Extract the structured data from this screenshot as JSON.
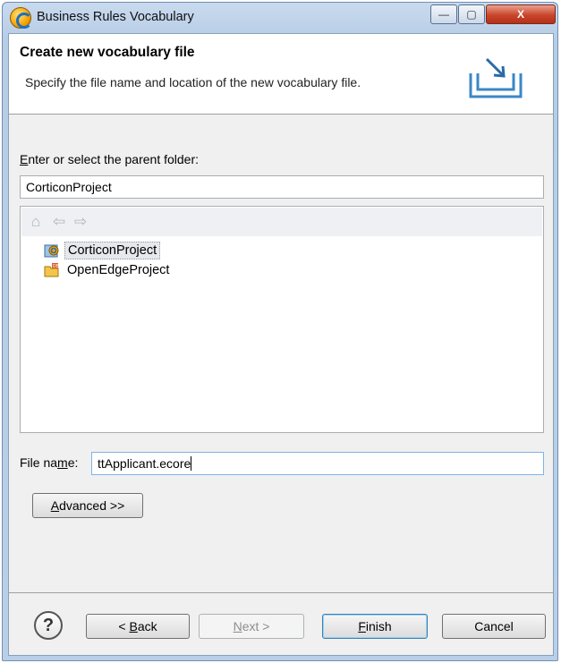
{
  "window": {
    "title": "Business Rules Vocabulary",
    "min_glyph": "—",
    "max_glyph": "▢",
    "close_glyph": "X"
  },
  "banner": {
    "title": "Create new vocabulary file",
    "description": "Specify the file name and location of the new vocabulary file.",
    "icon": "new-file-wizard-icon"
  },
  "parent_folder": {
    "label_mnemonic": "E",
    "label_rest": "nter or select the parent folder:",
    "value": "CorticonProject"
  },
  "tree_toolbar": {
    "home_icon": "home-icon",
    "back_icon": "back-arrow-icon",
    "forward_icon": "forward-arrow-icon"
  },
  "tree": {
    "items": [
      {
        "label": "CorticonProject",
        "icon": "corticon-project-icon",
        "selected": true
      },
      {
        "label": "OpenEdgeProject",
        "icon": "openedge-project-icon",
        "selected": false
      }
    ]
  },
  "file_name": {
    "label_pre": "File na",
    "label_mnemonic": "m",
    "label_post": "e:",
    "value": "ttApplicant.ecore"
  },
  "advanced_button": {
    "mnemonic": "A",
    "rest": "dvanced >>"
  },
  "footer": {
    "help_glyph": "?",
    "back": {
      "pre": "< ",
      "mnemonic": "B",
      "rest": "ack"
    },
    "next": {
      "mnemonic": "N",
      "rest": "ext >"
    },
    "finish": {
      "mnemonic": "F",
      "rest": "inish"
    },
    "cancel": "Cancel"
  }
}
